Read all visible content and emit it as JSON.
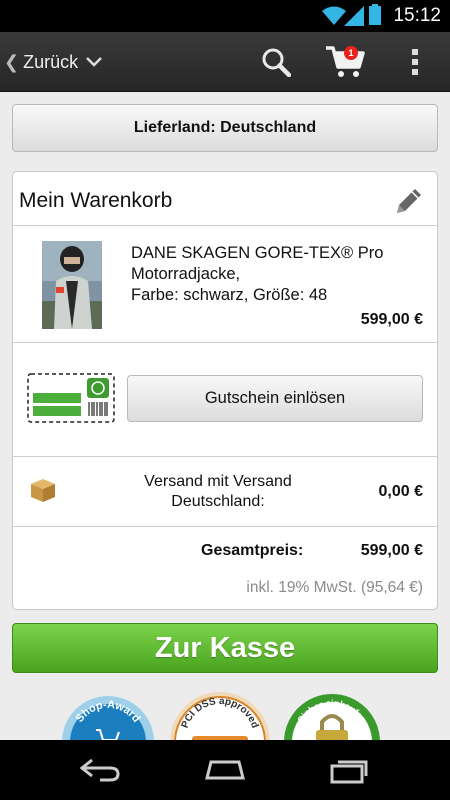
{
  "status_bar": {
    "time": "15:12"
  },
  "action_bar": {
    "back_label": "Zurück",
    "cart_count": "1",
    "icons": [
      "search-icon",
      "cart-icon",
      "overflow-menu-icon"
    ]
  },
  "country_button": {
    "label": "Lieferland: Deutschland"
  },
  "cart": {
    "title": "Mein Warenkorb",
    "product": {
      "name_line1": "DANE SKAGEN GORE-TEX® Pro",
      "name_line2": "Motorradjacke,",
      "name_line3": "Farbe: schwarz, Größe: 48",
      "price": "599,00 €"
    },
    "voucher_button": "Gutschein einlösen",
    "shipping": {
      "label_line1": "Versand mit Versand",
      "label_line2": "Deutschland:",
      "price": "0,00 €"
    },
    "total": {
      "label": "Gesamtpreis:",
      "price": "599,00 €",
      "vat": "inkl. 19% MwSt. (95,64 €)"
    }
  },
  "checkout_button": {
    "label": "Zur Kasse"
  },
  "trust_badges": {
    "shop_award": "Shop-Award",
    "pci": "PCI DSS approved",
    "secure": "Sicher einkaufen"
  },
  "colors": {
    "accent_green": "#5cb82e",
    "cart_badge_red": "#e8231e",
    "action_bar": "#2e2e2e"
  }
}
